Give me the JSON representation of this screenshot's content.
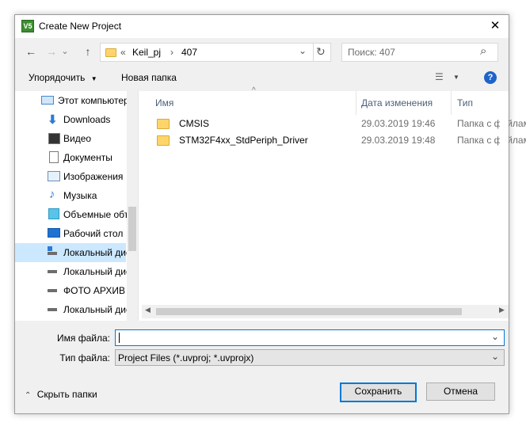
{
  "window": {
    "title": "Create New Project",
    "app_icon_text": "V5",
    "close_glyph": "✕"
  },
  "nav": {
    "back": "←",
    "forward": "→",
    "up": "↑",
    "dropdown": "⌄",
    "refresh": "↻"
  },
  "address": {
    "chevron": "«",
    "crumbs": [
      "Keil_pj",
      "407"
    ],
    "sep": "›",
    "dropdown": "⌄"
  },
  "search": {
    "placeholder": "Поиск: 407",
    "icon": "⌕"
  },
  "toolbar": {
    "organize": "Упорядочить",
    "new_folder": "Новая папка",
    "view_icon": "☰",
    "help": "?"
  },
  "sidebar": {
    "items": [
      {
        "label": "Этот компьютер",
        "icon": "computer-icon"
      },
      {
        "label": "Downloads",
        "icon": "download-icon"
      },
      {
        "label": "Видео",
        "icon": "video-icon"
      },
      {
        "label": "Документы",
        "icon": "documents-icon"
      },
      {
        "label": "Изображения",
        "icon": "pictures-icon"
      },
      {
        "label": "Музыка",
        "icon": "music-icon"
      },
      {
        "label": "Объемные объекты",
        "icon": "3d-objects-icon"
      },
      {
        "label": "Рабочий стол",
        "icon": "desktop-icon"
      },
      {
        "label": "Локальный диск",
        "icon": "drive-icon"
      },
      {
        "label": "Локальный диск",
        "icon": "drive-icon"
      },
      {
        "label": "ФОТО АРХИВ",
        "icon": "drive-icon"
      },
      {
        "label": "Локальный диск",
        "icon": "drive-icon"
      }
    ],
    "selected_index": 8
  },
  "filelist": {
    "columns": {
      "name": "Имя",
      "date": "Дата изменения",
      "type": "Тип"
    },
    "rows": [
      {
        "name": "CMSIS",
        "date": "29.03.2019 19:46",
        "type": "Папка с файлами"
      },
      {
        "name": "STM32F4xx_StdPeriph_Driver",
        "date": "29.03.2019 19:48",
        "type": "Папка с файлами"
      }
    ],
    "sort_arrow": "^"
  },
  "form": {
    "filename_label": "Имя файла:",
    "filename_value": "",
    "filetype_label": "Тип файла:",
    "filetype_value": "Project Files (*.uvproj; *.uvprojx)",
    "dropdown": "⌄"
  },
  "footer": {
    "hide_folders": "Скрыть папки",
    "save": "Сохранить",
    "cancel": "Отмена"
  },
  "colors": {
    "accent": "#0078d7",
    "selection": "#cce8ff",
    "folder": "#ffd56a",
    "help": "#1e64c8"
  }
}
